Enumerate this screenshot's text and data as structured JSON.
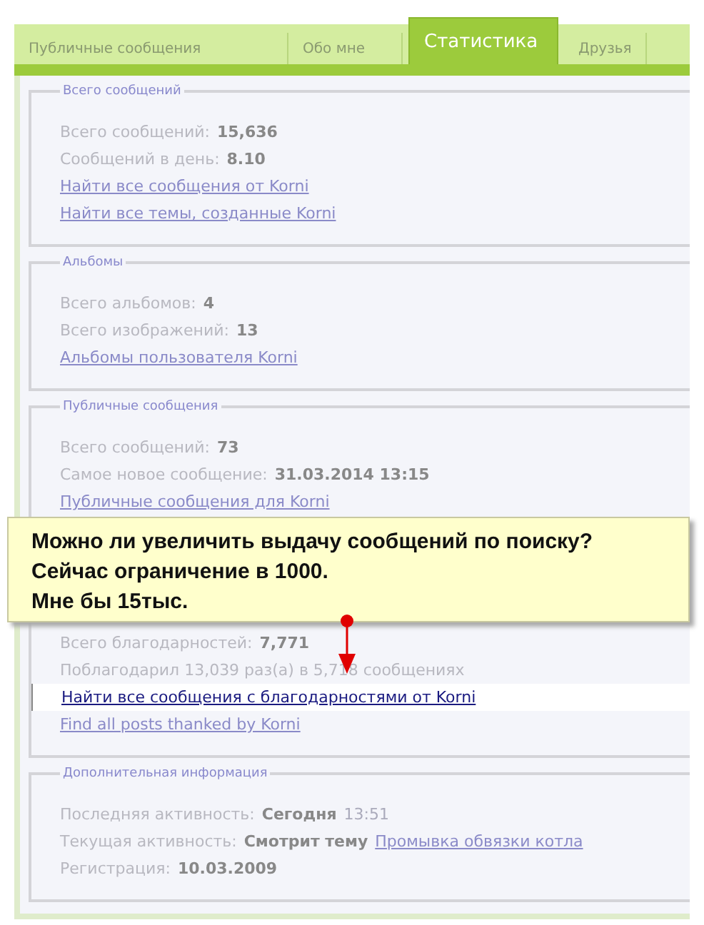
{
  "tabs": [
    {
      "label": "Публичные сообщения",
      "selected": false
    },
    {
      "label": "Обо мне",
      "selected": false
    },
    {
      "label": "Статистика",
      "selected": true
    },
    {
      "label": "Друзья",
      "selected": false
    }
  ],
  "sections": [
    {
      "legend": "Всего сообщений",
      "rows": [
        {
          "kind": "stat",
          "label": "Всего сообщений:",
          "value": "15,636"
        },
        {
          "kind": "stat",
          "label": "Сообщений в день:",
          "value": "8.10"
        },
        {
          "kind": "link",
          "text": "Найти все сообщения от Korni",
          "highlighted": false
        },
        {
          "kind": "link",
          "text": "Найти все темы, созданные Korni",
          "highlighted": false
        }
      ]
    },
    {
      "legend": "Альбомы",
      "rows": [
        {
          "kind": "stat",
          "label": "Всего альбомов:",
          "value": "4"
        },
        {
          "kind": "stat",
          "label": "Всего изображений:",
          "value": "13"
        },
        {
          "kind": "link",
          "text": "Альбомы пользователя Korni",
          "highlighted": false
        }
      ]
    },
    {
      "legend": "Публичные сообщения",
      "rows": [
        {
          "kind": "stat",
          "label": "Всего сообщений:",
          "value": "73"
        },
        {
          "kind": "stat",
          "label": "Самое новое сообщение:",
          "value": "31.03.2014 13:15"
        },
        {
          "kind": "link",
          "text": "Публичные сообщения для Korni",
          "highlighted": false
        },
        {
          "kind": "gap"
        },
        {
          "kind": "stat",
          "label": "Всего благодарностей:",
          "value": "7,771"
        },
        {
          "kind": "plain",
          "text": "Поблагодарил 13,039 раз(а) в 5,718 сообщениях"
        },
        {
          "kind": "link",
          "text": "Найти все сообщения с благодарностями от Korni",
          "highlighted": true
        },
        {
          "kind": "link",
          "text": "Find all posts thanked by Korni",
          "highlighted": false
        }
      ]
    },
    {
      "legend": "Дополнительная информация",
      "rows": [
        {
          "kind": "stat",
          "label": "Последняя активность:",
          "value": "Сегодня",
          "extra": "13:51"
        },
        {
          "kind": "stat",
          "label": "Текущая активность:",
          "value": "Смотрит тему",
          "link": "Промывка обвязки котла"
        },
        {
          "kind": "stat",
          "label": "Регистрация:",
          "value": "10.03.2009"
        }
      ]
    }
  ],
  "callout": {
    "lines": [
      "Можно ли увеличить  выдачу сообщений по поиску?",
      "Сейчас ограничение в 1000.",
      "Мне бы 15тыс."
    ]
  }
}
